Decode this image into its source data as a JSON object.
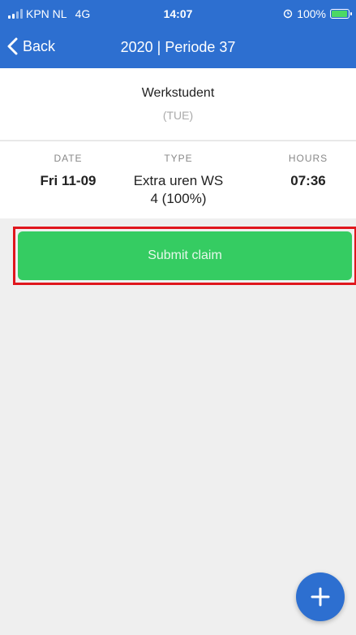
{
  "status_bar": {
    "carrier": "KPN NL",
    "network": "4G",
    "time": "14:07",
    "battery": "100%",
    "battery_level": 1.0
  },
  "nav": {
    "back_label": "Back",
    "title": "2020 | Periode 37"
  },
  "header": {
    "title": "Werkstudent",
    "subtitle": "(TUE)"
  },
  "entry": {
    "columns": [
      "DATE",
      "TYPE",
      "HOURS"
    ],
    "date": "Fri 11-09",
    "type_line1": "Extra uren WS",
    "type_line2": "4 (100%)",
    "hours": "07:36"
  },
  "actions": {
    "submit_label": "Submit claim"
  },
  "colors": {
    "primary": "#2d6fd0",
    "submit": "#35cc62",
    "highlight": "#e0161d"
  },
  "icons": [
    "signal-icon",
    "alarm-icon",
    "battery-icon",
    "chevron-left-icon",
    "plus-icon"
  ]
}
